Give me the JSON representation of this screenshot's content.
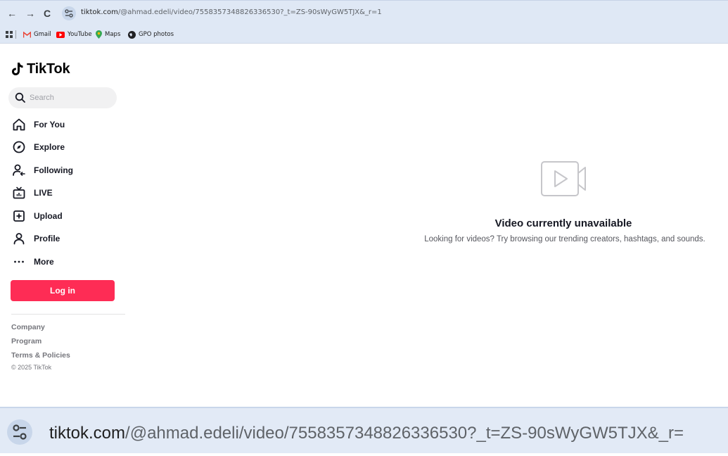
{
  "browser": {
    "url_host": "tiktok.com",
    "url_path": "/@ahmad.edeli/video/7558357348826336530?_t=ZS-90sWyGW5TJX&_r=1",
    "url_path_zoomed": "/@ahmad.edeli/video/7558357348826336530?_t=ZS-90sWyGW5TJX&_r=",
    "bookmarks": [
      {
        "label": "Gmail",
        "icon": "gmail-icon"
      },
      {
        "label": "YouTube",
        "icon": "youtube-icon"
      },
      {
        "label": "Maps",
        "icon": "maps-icon"
      },
      {
        "label": "GPO photos",
        "icon": "globe-icon"
      }
    ]
  },
  "tiktok": {
    "logo_text": "TikTok",
    "search_placeholder": "Search",
    "nav": [
      {
        "label": "For You",
        "icon": "home-icon"
      },
      {
        "label": "Explore",
        "icon": "compass-icon"
      },
      {
        "label": "Following",
        "icon": "following-icon"
      },
      {
        "label": "LIVE",
        "icon": "live-tv-icon"
      },
      {
        "label": "Upload",
        "icon": "upload-icon"
      },
      {
        "label": "Profile",
        "icon": "profile-icon"
      },
      {
        "label": "More",
        "icon": "more-dots-icon"
      }
    ],
    "login_label": "Log in",
    "footer_links": [
      "Company",
      "Program",
      "Terms & Policies"
    ],
    "copyright": "© 2025 TikTok"
  },
  "main": {
    "title": "Video currently unavailable",
    "subtitle": "Looking for videos? Try browsing our trending creators, hashtags, and sounds."
  },
  "colors": {
    "brand_red": "#fe2c55",
    "browser_chrome": "#dfe8f5"
  }
}
